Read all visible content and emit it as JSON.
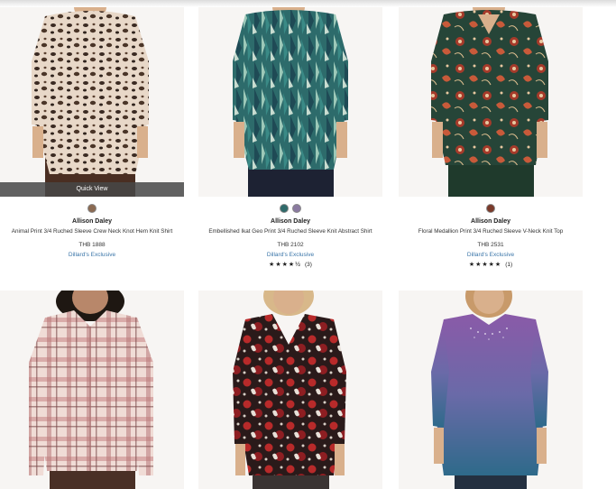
{
  "products": [
    {
      "quick_view": "Quick View",
      "swatch_colors": [
        "#8b6a52"
      ],
      "brand": "Allison Daley",
      "title": "Animal Print 3/4 Ruched Sleeve Crew Neck Knot Hem Knit Shirt",
      "price": "THB 1888",
      "exclusive": "Dillard's Exclusive"
    },
    {
      "swatch_colors": [
        "#2f6a6a",
        "#8a7aa0"
      ],
      "brand": "Allison Daley",
      "title": "Embellished Ikat Geo Print 3/4 Ruched Sleeve Knit Abstract Shirt",
      "price": "THB 2102",
      "exclusive": "Dillard's Exclusive",
      "stars": "★★★★½",
      "rating": 4.5,
      "review_count": "(3)"
    },
    {
      "swatch_colors": [
        "#7a3a2a"
      ],
      "brand": "Allison Daley",
      "title": "Floral Medallion Print 3/4 Ruched Sleeve V-Neck Knit Top",
      "price": "THB 2531",
      "exclusive": "Dillard's Exclusive",
      "stars": "★★★★★",
      "rating": 5,
      "review_count": "(1)"
    },
    {},
    {},
    {}
  ]
}
